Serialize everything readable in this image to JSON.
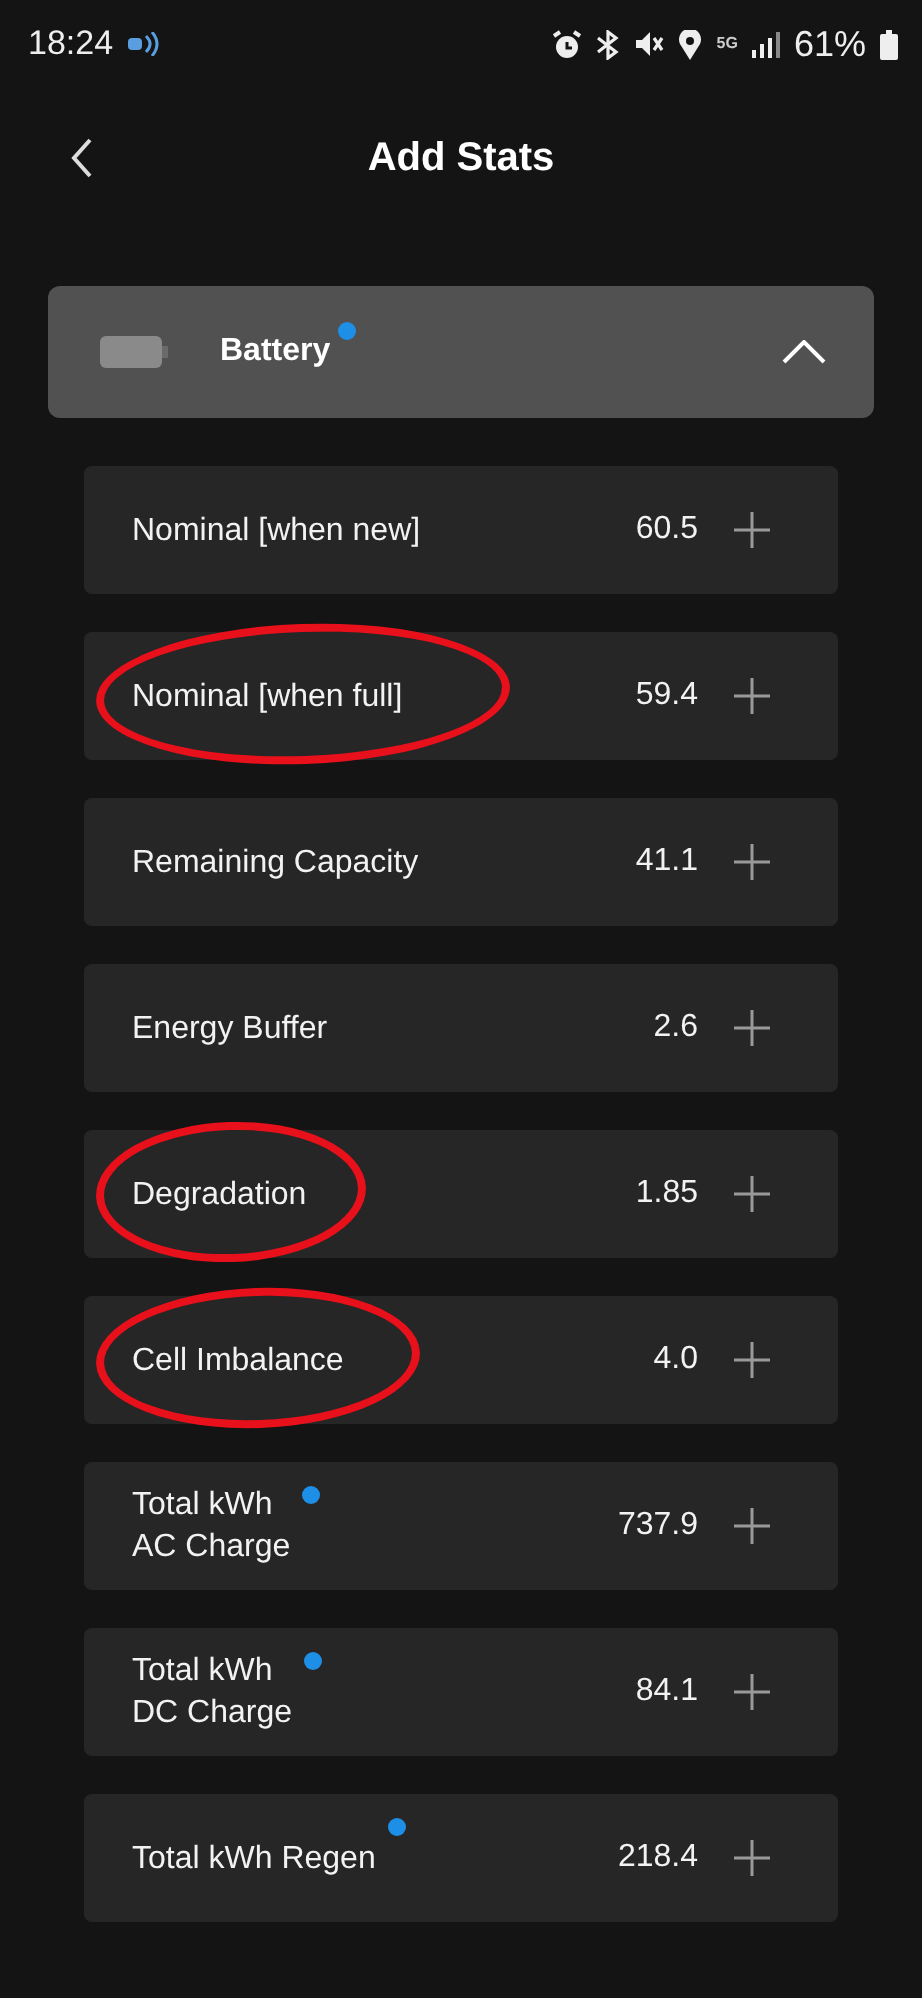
{
  "status_bar": {
    "time": "18:24",
    "network": "5G",
    "battery": "61%"
  },
  "header": {
    "title": "Add Stats"
  },
  "section": {
    "title": "Battery",
    "new": true,
    "expanded": true
  },
  "stats": [
    {
      "label": "Nominal [when new]",
      "value": "60.5",
      "new": false,
      "circled": false
    },
    {
      "label": "Nominal [when full]",
      "value": "59.4",
      "new": false,
      "circled": true
    },
    {
      "label": "Remaining Capacity",
      "value": "41.1",
      "new": false,
      "circled": false
    },
    {
      "label": "Energy Buffer",
      "value": "2.6",
      "new": false,
      "circled": false
    },
    {
      "label": "Degradation",
      "value": "1.85",
      "new": false,
      "circled": true
    },
    {
      "label": "Cell Imbalance",
      "value": "4.0",
      "new": false,
      "circled": true
    },
    {
      "label": "Total kWh\n AC Charge",
      "value": "737.9",
      "new": true,
      "circled": false
    },
    {
      "label": "Total kWh\n DC Charge",
      "value": "84.1",
      "new": true,
      "circled": false
    },
    {
      "label": "Total kWh Regen",
      "value": "218.4",
      "new": true,
      "circled": false
    }
  ]
}
